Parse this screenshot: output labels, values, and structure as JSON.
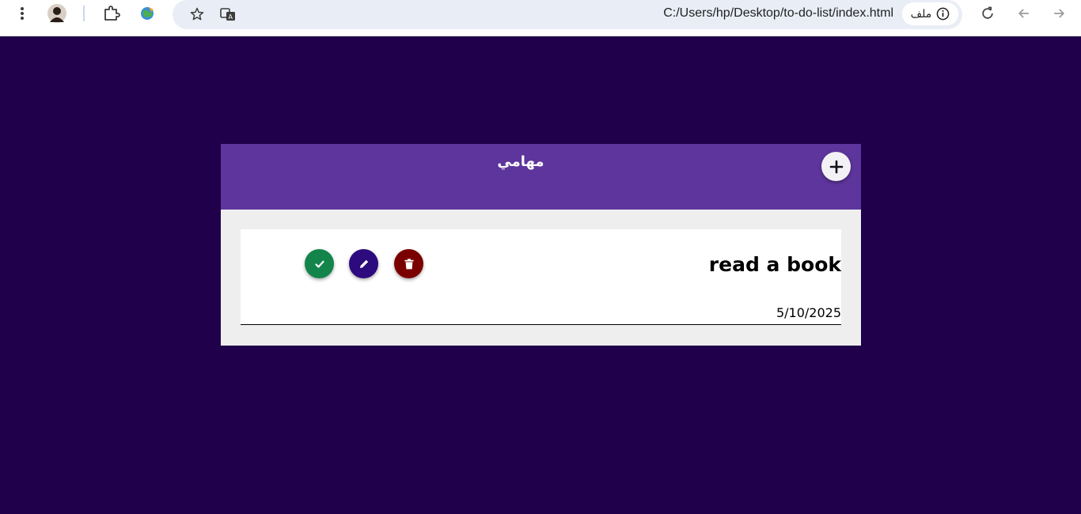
{
  "browser": {
    "url": "C:/Users/hp/Desktop/to-do-list/index.html",
    "site_chip_label": "ملف",
    "icons": {
      "menu": "kebab-menu-icon",
      "profile": "avatar",
      "extensions": "puzzle-icon",
      "extension_app": "globe-icon",
      "bookmark": "star-icon",
      "translate": "translate-icon",
      "site_info": "info-icon",
      "reload": "reload-icon",
      "back": "arrow-right-icon",
      "forward": "arrow-left-icon"
    }
  },
  "app": {
    "title": "مهامي",
    "add_icon": "plus-icon",
    "colors": {
      "page_background": "#20004b",
      "header": "#5d359c",
      "done": "#13854a",
      "edit": "#2d0a7e",
      "delete": "#7a0000"
    },
    "tasks": [
      {
        "title": "read a book",
        "date": "5/10/2025",
        "actions": {
          "done_icon": "check-icon",
          "edit_icon": "pencil-icon",
          "delete_icon": "trash-icon"
        }
      }
    ]
  }
}
